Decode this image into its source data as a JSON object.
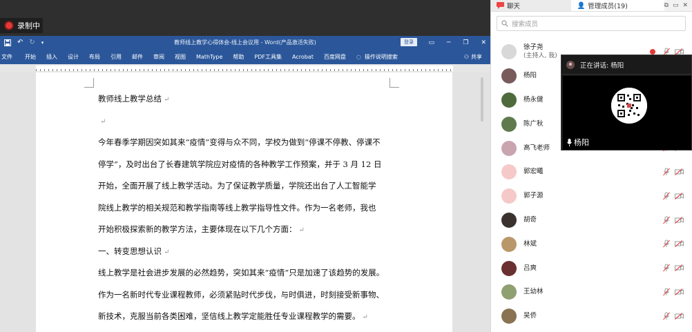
{
  "recording": {
    "label": "录制中"
  },
  "word": {
    "document_title": "教师线上教学心得体会-线上会议用 - Word(产品激活失败)",
    "login_button": "登录",
    "menu": [
      "文件",
      "开始",
      "插入",
      "设计",
      "布局",
      "引用",
      "邮件",
      "审阅",
      "视图",
      "MathType",
      "帮助",
      "PDF工具集",
      "Acrobat",
      "百度网盘",
      "操作说明搜索"
    ],
    "share_label": "共享",
    "paragraphs": [
      "教师线上教学总结",
      "",
      "今年春季学期因突如其来“疫情”变得与众不同，学校为做到“停课不停教、停课不",
      "停学”，及时出台了长春建筑学院应对疫情的各种教学工作预案，并于 3 月 12 日",
      "开始，全面开展了线上教学活动。为了保证教学质量，学院还出台了人工智能学",
      "院线上教学的相关规范和教学指南等线上教学指导性文件。作为一名老师，我也",
      "开始积极探索新的教学方法，主要体现在以下几个方面：",
      "一、转变思想认识",
      "线上教学是社会进步发展的必然趋势，突如其来“疫情”只是加速了该趋势的发展。",
      "作为一名新时代专业课程教师，必须紧贴时代步伐，与时俱进，时刻接受新事物、",
      "新技术，克服当前各类困难，坚信线上教学定能胜任专业课程教学的需要。"
    ],
    "paragraph_marks": [
      "↵",
      "↵",
      "",
      "",
      "",
      "",
      "↵",
      "↵",
      "",
      "",
      "↵"
    ]
  },
  "panel": {
    "chat_tab": "聊天",
    "members_tab": "管理成员(19)",
    "search_placeholder": "搜索成员",
    "members": [
      {
        "name": "徐子尧",
        "role": "(主持人, 我)",
        "color": "#d8d8d8"
      },
      {
        "name": "杨阳",
        "role": "",
        "color": "#7a5b5b"
      },
      {
        "name": "杨永健",
        "role": "",
        "color": "#4e6b3c"
      },
      {
        "name": "陈广秋",
        "role": "",
        "color": "#5f7b4d"
      },
      {
        "name": "高飞老师",
        "role": "",
        "color": "#c9a5b0"
      },
      {
        "name": "郭宏曦",
        "role": "",
        "color": "#f6c9c9"
      },
      {
        "name": "郭子源",
        "role": "",
        "color": "#f6c9c9"
      },
      {
        "name": "胡奇",
        "role": "",
        "color": "#3b3230"
      },
      {
        "name": "林斌",
        "role": "",
        "color": "#b9976a"
      },
      {
        "name": "吕爽",
        "role": "",
        "color": "#6a2f2f"
      },
      {
        "name": "王幼林",
        "role": "",
        "color": "#8fa071"
      },
      {
        "name": "吴侨",
        "role": "",
        "color": "#8a7350"
      }
    ]
  },
  "video": {
    "speaking_label": "正在讲话: 杨阳",
    "speaker_name": "杨阳"
  },
  "colors": {
    "word_blue": "#2b579a",
    "record_red": "#e53935",
    "mute_red": "#e05050"
  }
}
